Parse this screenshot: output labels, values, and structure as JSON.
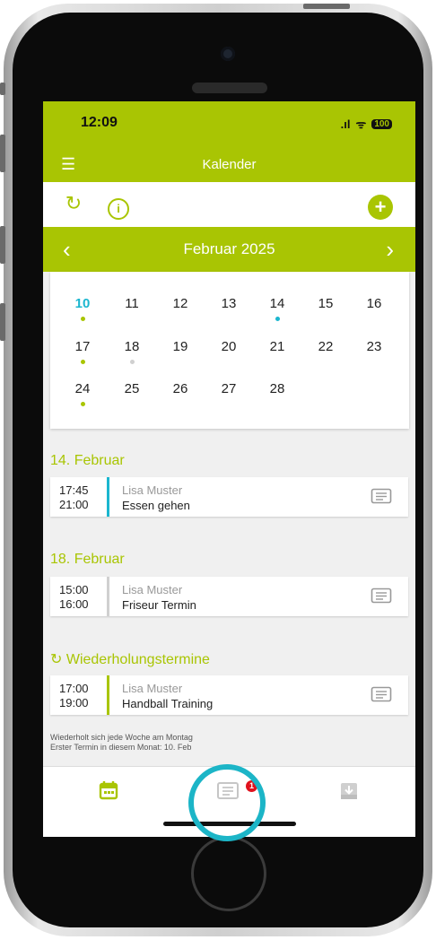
{
  "status_bar": {
    "time": "12:09",
    "signal": ".ıl",
    "wifi": "ᯤ",
    "battery": "100"
  },
  "app_bar": {
    "title": "Kalender",
    "menu_icon": "menu-icon"
  },
  "toolbar": {
    "refresh_icon": "refresh-icon",
    "info_icon": "info-icon",
    "info_glyph": "i",
    "add_icon": "add-icon",
    "add_glyph": "+"
  },
  "month_bar": {
    "label": "Februar 2025",
    "prev": "‹",
    "next": "›"
  },
  "calendar": {
    "weeks": [
      [
        "10",
        "11",
        "12",
        "13",
        "14",
        "15",
        "16"
      ],
      [
        "17",
        "18",
        "19",
        "20",
        "21",
        "22",
        "23"
      ],
      [
        "24",
        "25",
        "26",
        "27",
        "28"
      ]
    ],
    "today": "10"
  },
  "sections": [
    {
      "title": "14. Februar",
      "events": [
        {
          "start": "17:45",
          "end": "21:00",
          "person": "Lisa Muster",
          "title": "Essen gehen",
          "color": "#1bb6cf"
        }
      ]
    },
    {
      "title": "18. Februar",
      "events": [
        {
          "start": "15:00",
          "end": "16:00",
          "person": "Lisa Muster",
          "title": "Friseur Termin",
          "color": "#d0d0d0"
        }
      ]
    },
    {
      "title": "↻ Wiederholungstermine",
      "events": [
        {
          "start": "17:00",
          "end": "19:00",
          "person": "Lisa Muster",
          "title": "Handball Training",
          "color": "#a9c503"
        }
      ]
    }
  ],
  "recurrence": {
    "line1": "Wiederholt sich jede Woche am Montag",
    "line2": "Erster Termin in diesem Monat: 10. Feb"
  },
  "bottom_nav": {
    "calendar_icon": "calendar-icon",
    "messages_icon": "messages-icon",
    "inbox_icon": "inbox-icon",
    "badge": "1"
  },
  "colors": {
    "accent": "#a9c503",
    "highlight": "#1bb6cf",
    "badge": "#e0121d"
  }
}
